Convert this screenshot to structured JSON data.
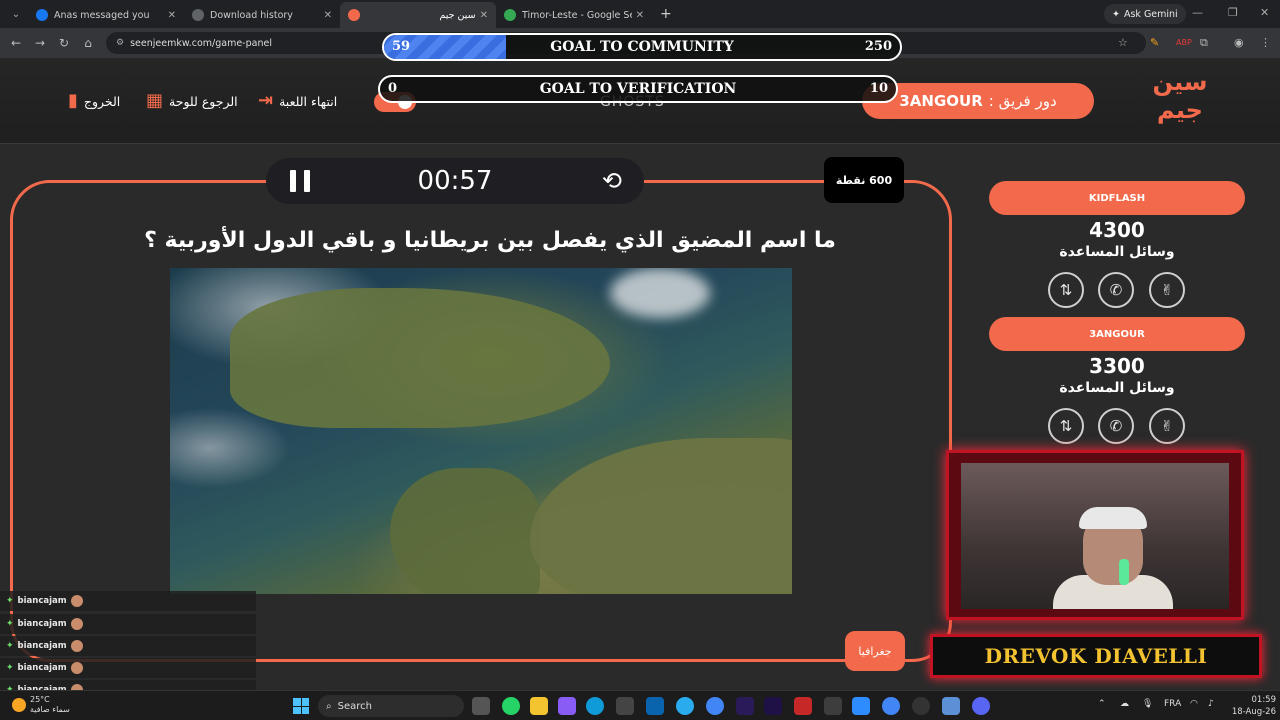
{
  "browser": {
    "tabs": [
      {
        "title": "Anas messaged you",
        "active": false,
        "color": "#1877f2"
      },
      {
        "title": "Download history",
        "active": false,
        "color": "#9aa0a6"
      },
      {
        "title": "سين جيم",
        "active": true,
        "color": "#f26a4b"
      },
      {
        "title": "Timor-Leste - Google Search",
        "active": false,
        "color": "#34a853"
      }
    ],
    "ask_gemini": "Ask Gemini",
    "url": "seenjeemkw.com/game-panel"
  },
  "header": {
    "logo_text": "سين جيم",
    "team_turn_label": "دور فريق :",
    "team_turn_name": "3ANGOUR",
    "actions": {
      "exit": "الخروج",
      "back_to_board": "الرجوع للوحة",
      "end_game": "انتهاء اللعبة"
    },
    "ghosts": "GHOSTS"
  },
  "goals": [
    {
      "label": "GOAL TO COMMUNITY",
      "current": "59",
      "target": "250",
      "progress": 0.236
    },
    {
      "label": "GOAL TO VERIFICATION",
      "current": "0",
      "target": "10",
      "progress": 0
    }
  ],
  "question": {
    "timer": "00:57",
    "points": "600 نقطة",
    "text": "ما اسم المضيق الذي يفصل بين بريطانيا و باقي الدول الأوربية ؟",
    "category": "جغرافيا"
  },
  "teams": [
    {
      "name": "KIDFLASH",
      "score": "4300",
      "aids_label": "وسائل المساعدة"
    },
    {
      "name": "3ANGOUR",
      "score": "3300",
      "aids_label": "وسائل المساعدة"
    }
  ],
  "stream": {
    "nameplate": "DREVOK DIAVELLI",
    "chat": [
      "biancajam",
      "biancajam",
      "biancajam",
      "biancajam",
      "biancajam"
    ]
  },
  "taskbar": {
    "temp": "25°C",
    "weather": "سماء صافية",
    "search": "Search",
    "lang": "FRA",
    "time": "01:59",
    "date": "18-Aug-26"
  }
}
